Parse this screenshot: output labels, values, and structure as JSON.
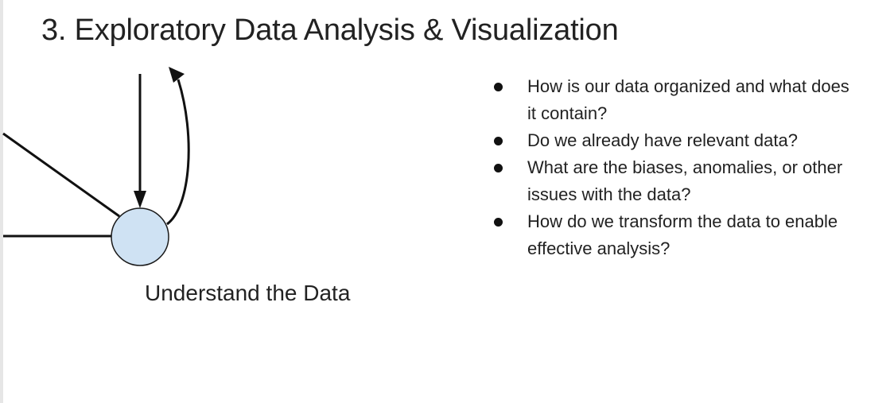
{
  "slide": {
    "title": "3. Exploratory Data Analysis & Visualization"
  },
  "diagram": {
    "node_label": "Understand the Data",
    "node_fill": "#cfe2f3",
    "node_stroke": "#1a1a1a"
  },
  "bullets": [
    {
      "text": "How is our data organized and what does it contain?"
    },
    {
      "text": "Do we already have relevant data?"
    },
    {
      "text": "What are the biases, anomalies, or other issues with the data?"
    },
    {
      "text": "How do we transform the data to enable effective analysis?"
    }
  ]
}
